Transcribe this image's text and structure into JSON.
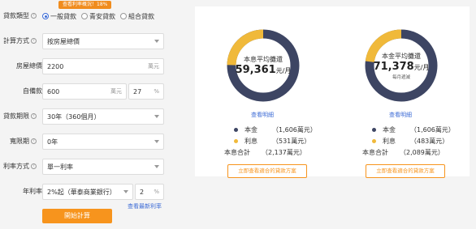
{
  "badge": "查看利率概況！18%",
  "loan_type": {
    "label": "貸款類型",
    "options": [
      "一般貸款",
      "青安貸款",
      "組合貸款"
    ],
    "selected": 0
  },
  "form": {
    "calc_method": {
      "label": "計算方式",
      "value": "按房屋總價"
    },
    "total_price": {
      "label": "房屋總價",
      "value": "2200",
      "unit": "萬元"
    },
    "down_payment": {
      "label": "自備款",
      "value": "600",
      "unit": "萬元",
      "percent": "27",
      "percent_unit": "%"
    },
    "loan_term": {
      "label": "貸款期限",
      "value": "30年（360個月）"
    },
    "grace_period": {
      "label": "寬限期",
      "value": "0年"
    },
    "rate_method": {
      "label": "利率方式",
      "value": "單一利率"
    },
    "annual_rate": {
      "label": "年利率",
      "value": "2%起（華泰商業銀行）",
      "adjust": "2",
      "unit": "%"
    },
    "latest_rate_link": "查看最新利率",
    "calc_button": "開始計算"
  },
  "results": [
    {
      "center_label": "本息平均攤還",
      "amount": "59,361",
      "amount_unit": "元/月",
      "sub": "",
      "detail_link": "查看明細",
      "principal_label": "本金",
      "principal_value": "（1,606萬元）",
      "interest_label": "利息",
      "interest_value": "（531萬元）",
      "total_label": "本息合計",
      "total_value": "（2,137萬元）",
      "plan_button": "立即查看適合的貸款方案",
      "interest_fraction": 0.2485
    },
    {
      "center_label": "本金平均攤還",
      "amount": "71,378",
      "amount_unit": "元/月",
      "sub": "每月遞減",
      "detail_link": "查看明細",
      "principal_label": "本金",
      "principal_value": "（1,606萬元）",
      "interest_label": "利息",
      "interest_value": "（483萬元）",
      "total_label": "本息合計",
      "total_value": "（2,089萬元）",
      "plan_button": "立即查看適合的貸款方案",
      "interest_fraction": 0.2312
    }
  ],
  "colors": {
    "principal": "#3d4563",
    "interest": "#f0b93a",
    "accent": "#f7941d",
    "link": "#3c6bd6"
  }
}
